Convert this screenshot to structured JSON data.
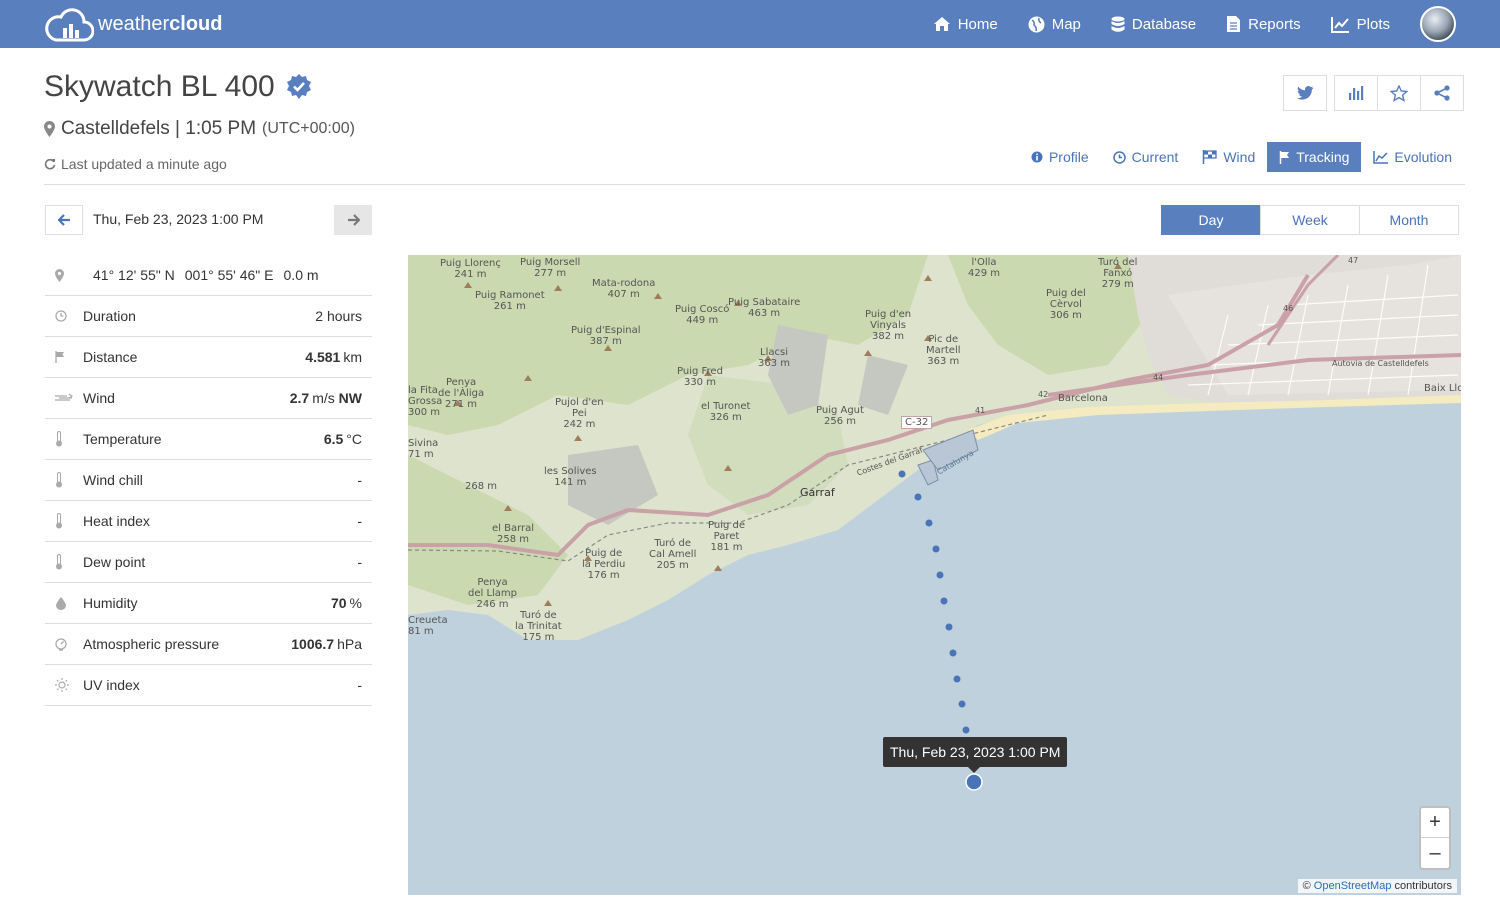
{
  "app": {
    "logo_text_light": "weather",
    "logo_text_bold": "cloud"
  },
  "nav": {
    "items": [
      {
        "label": "Home",
        "icon": "home-icon"
      },
      {
        "label": "Map",
        "icon": "globe-icon"
      },
      {
        "label": "Database",
        "icon": "database-icon"
      },
      {
        "label": "Reports",
        "icon": "report-icon"
      },
      {
        "label": "Plots",
        "icon": "chart-line-icon"
      }
    ]
  },
  "station": {
    "name": "Skywatch BL 400",
    "location": "Castelldefels | 1:05 PM",
    "timezone": "(UTC+00:00)",
    "updated": "Last updated a minute ago"
  },
  "actions": [
    "twitter-icon",
    "bar-chart-icon",
    "star-icon",
    "share-icon"
  ],
  "tabs": {
    "profile": "Profile",
    "current": "Current",
    "wind": "Wind",
    "tracking": "Tracking",
    "evolution": "Evolution"
  },
  "date_nav": {
    "label": "Thu, Feb 23, 2023 1:00 PM"
  },
  "stats": {
    "coords": {
      "lat": "41° 12' 55\" N",
      "lon": "001° 55' 46\" E",
      "alt": "0.0 m"
    },
    "rows": [
      {
        "label": "Duration",
        "value": "2 hours",
        "unit": ""
      },
      {
        "label": "Distance",
        "value": "4.581",
        "unit": "km"
      },
      {
        "label": "Wind",
        "value": "2.7",
        "unit": "m/s",
        "extra": "NW"
      },
      {
        "label": "Temperature",
        "value": "6.5",
        "unit": "°C"
      },
      {
        "label": "Wind chill",
        "value": "-",
        "unit": ""
      },
      {
        "label": "Heat index",
        "value": "-",
        "unit": ""
      },
      {
        "label": "Dew point",
        "value": "-",
        "unit": ""
      },
      {
        "label": "Humidity",
        "value": "70",
        "unit": "%"
      },
      {
        "label": "Atmospheric pressure",
        "value": "1006.7",
        "unit": "hPa"
      },
      {
        "label": "UV index",
        "value": "-",
        "unit": ""
      }
    ]
  },
  "period": {
    "day": "Day",
    "week": "Week",
    "month": "Month"
  },
  "map": {
    "tooltip": "Thu, Feb 23, 2023 1:00 PM",
    "zoom_in": "+",
    "zoom_out": "–",
    "attribution_prefix": "©",
    "attribution_link": "OpenStreetMap",
    "attribution_suffix": "contributors",
    "labels": {
      "l1": "Puig Llorenç\n241 m",
      "l2": "Puig Morsell\n277 m",
      "l3": "l'Olla\n429 m",
      "l4": "Turó del\nFanxó\n279 m",
      "l5": "Puig Ramonet\n261 m",
      "l6": "Mata-rodona\n407 m",
      "l7": "Puig Coscó\n449 m",
      "l8": "Puig Sabataire\n463 m",
      "l9": "Puig d'en\nVinyals\n382 m",
      "l10": "Puig del\nCèrvol\n306 m",
      "l11": "Puig d'Espinal\n387 m",
      "l12": "Pic de\nMartell\n363 m",
      "l13": "Llacsi\n363 m",
      "l14": "Puig Fred\n330 m",
      "l15": "Penya\nde l'Àliga\n271 m",
      "l16": "la Fita\nGrossa\n300 m",
      "l17": "Pujol d'en\nPei\n242 m",
      "l18": "el Turonet\n326 m",
      "l19": "Puig Agut\n256 m",
      "l20": "C-32",
      "l21": "Barcelona",
      "l22": "Autovia de Castelldefels",
      "l23": "Sivina\n71 m",
      "l24": "les Solives\n141 m",
      "l25": "268 m",
      "l26": "Garraf",
      "l27": "el Barral\n258 m",
      "l28": "Puig de\nParet\n181 m",
      "l29": "Turó de\nCal Amell\n205 m",
      "l30": "Puig de\nla Perdiu\n176 m",
      "l31": "Penya\ndel Llamp\n246 m",
      "l32": "Creueta\n81 m",
      "l33": "Turó de\nla Trinitat\n175 m",
      "l34": "Costes del Garraf",
      "l35": "Catalunya",
      "l36": "Baix Llo",
      "r41": "41",
      "r42": "42",
      "r44": "44",
      "r46": "46",
      "r47": "47"
    }
  }
}
